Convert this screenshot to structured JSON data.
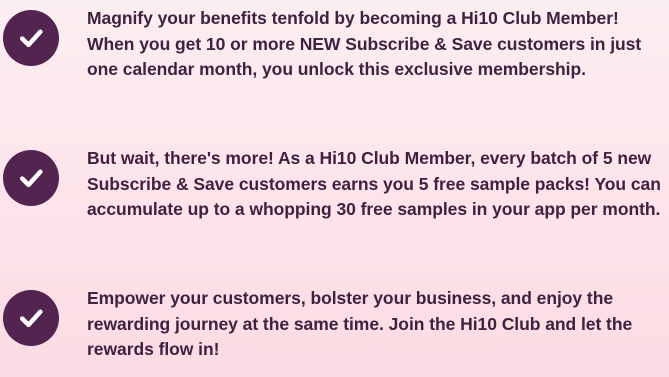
{
  "theme": {
    "badge_color": "#52244f",
    "check_color": "#ffffff",
    "text_color": "#3f2140"
  },
  "benefits": [
    {
      "icon": "check-circle-icon",
      "text": "Magnify your benefits tenfold by becoming a Hi10 Club Member! When you get 10 or more NEW Subscribe & Save customers in just one calendar month, you unlock this exclusive membership."
    },
    {
      "icon": "check-circle-icon",
      "text": "But wait, there's more! As a Hi10 Club Member, every batch of 5 new Subscribe & Save customers earns you 5 free sample packs! You can accumulate up to a whopping 30 free samples in your app per month."
    },
    {
      "icon": "check-circle-icon",
      "text": "Empower your customers, bolster your business, and enjoy the rewarding journey at the same time. Join the Hi10 Club and let the rewards flow in!"
    }
  ]
}
